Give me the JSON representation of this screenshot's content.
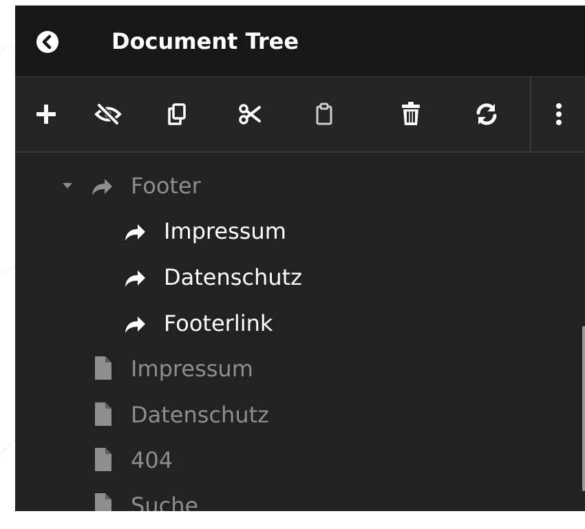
{
  "header": {
    "title": "Document Tree",
    "back_icon": "chevron-left-circle-icon"
  },
  "toolbar": {
    "buttons": [
      {
        "name": "add",
        "icon": "plus-icon"
      },
      {
        "name": "toggle-visibility",
        "icon": "eye-slash-icon"
      },
      {
        "name": "copy",
        "icon": "copy-icon"
      },
      {
        "name": "cut",
        "icon": "scissors-icon"
      },
      {
        "name": "paste",
        "icon": "clipboard-icon"
      },
      {
        "name": "delete",
        "icon": "trash-icon"
      },
      {
        "name": "refresh",
        "icon": "refresh-icon"
      },
      {
        "name": "more",
        "icon": "more-vertical-icon"
      }
    ]
  },
  "tree": {
    "items": [
      {
        "label": "Footer",
        "icon": "share-arrow-icon",
        "expanded": true,
        "state": "dimmed"
      },
      {
        "label": "Impressum",
        "icon": "share-arrow-icon",
        "state": "active"
      },
      {
        "label": "Datenschutz",
        "icon": "share-arrow-icon",
        "state": "active"
      },
      {
        "label": "Footerlink",
        "icon": "share-arrow-icon",
        "state": "active"
      },
      {
        "label": "Impressum",
        "icon": "document-icon",
        "state": "dimmed"
      },
      {
        "label": "Datenschutz",
        "icon": "document-icon",
        "state": "dimmed"
      },
      {
        "label": "404",
        "icon": "document-icon",
        "state": "dimmed"
      },
      {
        "label": "Suche",
        "icon": "document-icon",
        "state": "dimmed"
      }
    ]
  },
  "colors": {
    "header_bg": "#171717",
    "panel_bg": "#222222",
    "text_active": "#ffffff",
    "text_dimmed": "#8e8e8e"
  }
}
